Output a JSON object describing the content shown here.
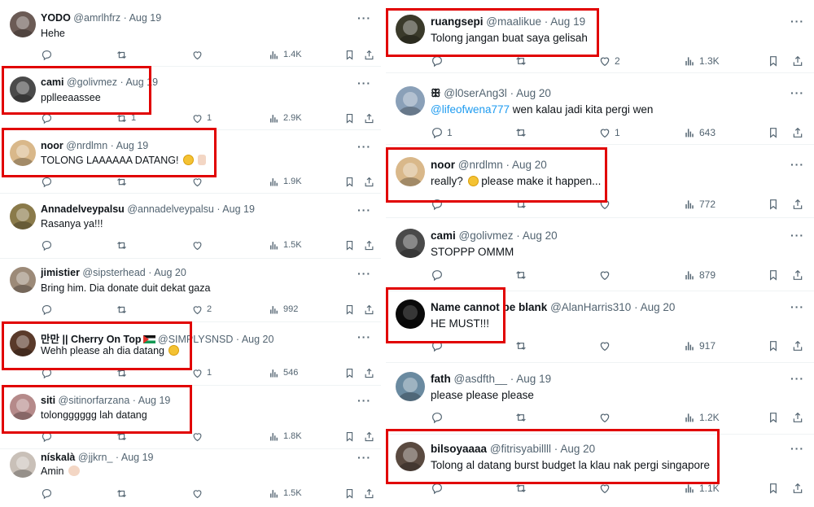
{
  "left": [
    {
      "name": "YODO",
      "handle": "@amrlhfrz",
      "dot": "·",
      "date": "Aug 19",
      "text": "Hehe",
      "reply": "",
      "retweet": "",
      "like": "",
      "views": "1.4K",
      "avatar_color": "#6b5b55"
    },
    {
      "name": "cami",
      "handle": "@golivmez",
      "dot": "·",
      "date": "Aug 19",
      "text": "pplleeaassee",
      "reply": "",
      "retweet": "1",
      "like": "1",
      "views": "2.9K",
      "avatar_color": "#4a4a4a"
    },
    {
      "name": "noor",
      "handle": "@nrdlmn",
      "dot": "·",
      "date": "Aug 19",
      "text": "TOLONG LAAAAAA DATANG!",
      "reply": "",
      "retweet": "",
      "like": "",
      "views": "1.9K",
      "avatar_color": "#d9b88a"
    },
    {
      "name": "Annadelveypalsu",
      "handle": "@annadelveypalsu",
      "dot": "·",
      "date": "Aug 19",
      "text": "Rasanya ya!!!",
      "reply": "",
      "retweet": "",
      "like": "",
      "views": "1.5K",
      "avatar_color": "#8a7a4a"
    },
    {
      "name": "jimistier",
      "handle": "@sipsterhead",
      "dot": "·",
      "date": "Aug 20",
      "text": "Bring him. Dia donate duit dekat gaza",
      "reply": "",
      "retweet": "",
      "like": "2",
      "views": "992",
      "avatar_color": "#9c8a78"
    },
    {
      "name": "만만 || Cherry On Top",
      "handle": "@SIMPLYSNSD",
      "dot": "·",
      "date": "Aug 20",
      "text": "Wehh please ah dia datang",
      "reply": "",
      "retweet": "",
      "like": "1",
      "views": "546",
      "avatar_color": "#5a3a2a"
    },
    {
      "name": "siti",
      "handle": "@sitinorfarzana",
      "dot": "·",
      "date": "Aug 19",
      "text": "tolongggggg lah datang",
      "reply": "",
      "retweet": "",
      "like": "",
      "views": "1.8K",
      "avatar_color": "#b58a8a"
    },
    {
      "name": "nískalà",
      "handle": "@jjkrn_",
      "dot": "·",
      "date": "Aug 19",
      "text": "Amin",
      "reply": "",
      "retweet": "",
      "like": "",
      "views": "1.5K",
      "avatar_color": "#c9c0b8"
    }
  ],
  "right": [
    {
      "name": "ruangsepi",
      "handle": "@maalikue",
      "dot": "·",
      "date": "Aug 19",
      "text": "Tolong jangan buat saya gelisah",
      "reply": "",
      "retweet": "",
      "like": "2",
      "views": "1.3K",
      "avatar_color": "#3a3a2a"
    },
    {
      "name": "ꕥ",
      "handle": "@l0serAng3l",
      "dot": "·",
      "date": "Aug 20",
      "mention": "@lifeofwena777",
      "text": " wen kalau jadi kita pergi wen",
      "reply": "1",
      "retweet": "",
      "like": "1",
      "views": "643",
      "avatar_color": "#8aa0b8"
    },
    {
      "name": "noor",
      "handle": "@nrdlmn",
      "dot": "·",
      "date": "Aug 20",
      "text": "really?",
      "text2": " please make it happen...",
      "reply": "",
      "retweet": "",
      "like": "",
      "views": "772",
      "avatar_color": "#d9b88a"
    },
    {
      "name": "cami",
      "handle": "@golivmez",
      "dot": "·",
      "date": "Aug 20",
      "text": "STOPPP OMMM",
      "reply": "",
      "retweet": "",
      "like": "",
      "views": "879",
      "avatar_color": "#4a4a4a"
    },
    {
      "name": "Name cannot be blank",
      "handle": "@AlanHarris310",
      "dot": "·",
      "date": "Aug 20",
      "text": "HE MUST!!!",
      "reply": "",
      "retweet": "",
      "like": "",
      "views": "917",
      "avatar_color": "#0a0a0a"
    },
    {
      "name": "fath",
      "handle": "@asdfth__",
      "dot": "·",
      "date": "Aug 19",
      "text": "please please please",
      "reply": "",
      "retweet": "",
      "like": "",
      "views": "1.2K",
      "avatar_color": "#6a8aa0"
    },
    {
      "name": "bilsoyaaaa",
      "handle": "@fitrisyabillll",
      "dot": "·",
      "date": "Aug 20",
      "text": "Tolong al datang burst budget la klau nak pergi singapore",
      "reply": "",
      "retweet": "",
      "like": "",
      "views": "1.1K",
      "avatar_color": "#5a4a40"
    }
  ],
  "more_glyph": "···",
  "colors": {
    "highlight": "#e10000",
    "mention": "#1d9bf0",
    "muted": "#536471"
  }
}
